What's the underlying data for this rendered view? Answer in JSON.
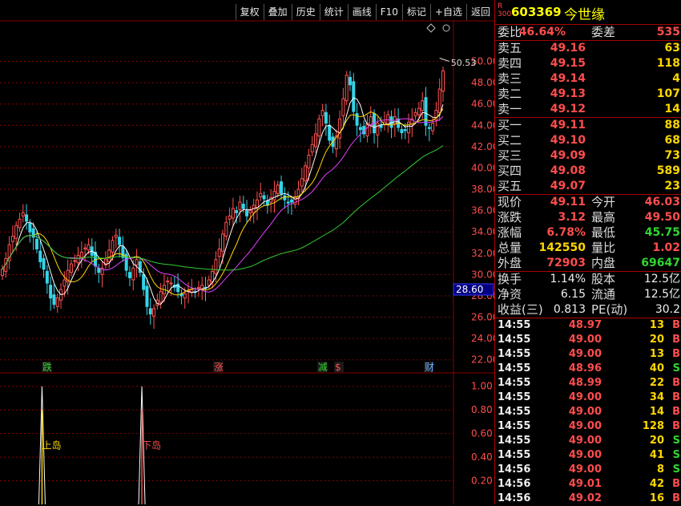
{
  "toolbar": [
    "复权",
    "叠加",
    "历史",
    "统计",
    "画线",
    "F10",
    "标记",
    "+自选",
    "返回"
  ],
  "stock": {
    "r_label": "R",
    "board": "300",
    "code": "603369",
    "name": "今世缘"
  },
  "quote": {
    "weibi_label": "委比",
    "weibi": "46.64%",
    "weicha_label": "委差",
    "weicha": "535",
    "asks": [
      {
        "label": "卖五",
        "price": "49.16",
        "vol": "63"
      },
      {
        "label": "卖四",
        "price": "49.15",
        "vol": "118"
      },
      {
        "label": "卖三",
        "price": "49.14",
        "vol": "4"
      },
      {
        "label": "卖二",
        "price": "49.13",
        "vol": "107"
      },
      {
        "label": "卖一",
        "price": "49.12",
        "vol": "14"
      }
    ],
    "bids": [
      {
        "label": "买一",
        "price": "49.11",
        "vol": "88"
      },
      {
        "label": "买二",
        "price": "49.10",
        "vol": "68"
      },
      {
        "label": "买三",
        "price": "49.09",
        "vol": "73"
      },
      {
        "label": "买四",
        "price": "49.08",
        "vol": "589"
      },
      {
        "label": "买五",
        "price": "49.07",
        "vol": "23"
      }
    ],
    "stats": [
      {
        "l1": "现价",
        "v1": "49.11",
        "c1": "red",
        "l2": "今开",
        "v2": "46.03",
        "c2": "red"
      },
      {
        "l1": "涨跌",
        "v1": "3.12",
        "c1": "red",
        "l2": "最高",
        "v2": "49.50",
        "c2": "red"
      },
      {
        "l1": "涨幅",
        "v1": "6.78%",
        "c1": "red",
        "l2": "最低",
        "v2": "45.75",
        "c2": "green"
      },
      {
        "l1": "总量",
        "v1": "142550",
        "c1": "yellow",
        "l2": "量比",
        "v2": "1.02",
        "c2": "red"
      },
      {
        "l1": "外盘",
        "v1": "72903",
        "c1": "red",
        "l2": "内盘",
        "v2": "69647",
        "c2": "green"
      }
    ],
    "stats2": [
      {
        "l1": "换手",
        "v1": "1.14%",
        "l2": "股本",
        "v2": "12.5亿"
      },
      {
        "l1": "净资",
        "v1": "6.15",
        "l2": "流通",
        "v2": "12.5亿"
      },
      {
        "l1": "收益(三)",
        "v1": "0.813",
        "l2": "PE(动)",
        "v2": "30.2"
      }
    ]
  },
  "ticks": [
    {
      "time": "14:55",
      "price": "48.97",
      "vol": "13",
      "bs": "B"
    },
    {
      "time": "14:55",
      "price": "49.00",
      "vol": "20",
      "bs": "B"
    },
    {
      "time": "14:55",
      "price": "49.00",
      "vol": "13",
      "bs": "B"
    },
    {
      "time": "14:55",
      "price": "48.96",
      "vol": "40",
      "bs": "S"
    },
    {
      "time": "14:55",
      "price": "48.99",
      "vol": "22",
      "bs": "B"
    },
    {
      "time": "14:55",
      "price": "49.00",
      "vol": "34",
      "bs": "B"
    },
    {
      "time": "14:55",
      "price": "49.00",
      "vol": "14",
      "bs": "B"
    },
    {
      "time": "14:55",
      "price": "49.00",
      "vol": "128",
      "bs": "B"
    },
    {
      "time": "14:55",
      "price": "49.00",
      "vol": "20",
      "bs": "S"
    },
    {
      "time": "14:55",
      "price": "49.00",
      "vol": "41",
      "bs": "S"
    },
    {
      "time": "14:56",
      "price": "49.00",
      "vol": "8",
      "bs": "S"
    },
    {
      "time": "14:56",
      "price": "49.01",
      "vol": "42",
      "bs": "B"
    },
    {
      "time": "14:56",
      "price": "49.02",
      "vol": "16",
      "bs": "B"
    }
  ],
  "chart_data": {
    "type": "candlestick",
    "price_axis": [
      22,
      24,
      26,
      28,
      30,
      32,
      34,
      36,
      38,
      40,
      42,
      44,
      46,
      48,
      50
    ],
    "price_tick_labels": [
      "22.00",
      "24.00",
      "26.00",
      "28.00",
      "30.00",
      "32.00",
      "34.00",
      "36.00",
      "38.00",
      "40.00",
      "42.00",
      "44.00",
      "46.00",
      "48.00",
      "50.00"
    ],
    "ylim": [
      21,
      53.5
    ],
    "peak_label": "50.53",
    "current_marker": "28.60",
    "event_markers": [
      {
        "label": "跌",
        "color": "#2fd62f"
      },
      {
        "label": "涨",
        "color": "#ff4d4d"
      },
      {
        "label": "减",
        "color": "#2fd62f"
      },
      {
        "label": "$",
        "color": "#ff4d4d"
      },
      {
        "label": "财",
        "color": "#6ab0ff"
      }
    ],
    "indicator_axis": [
      0.2,
      0.4,
      0.6,
      0.8,
      1.0
    ],
    "indicator_tick_labels": [
      "0.20",
      "0.40",
      "0.60",
      "0.80",
      "1.00"
    ],
    "indicator_ylim": [
      0,
      1.1
    ],
    "indicator_labels": [
      {
        "label": "上岛",
        "color": "#ffd700"
      },
      {
        "label": "下岛",
        "color": "#ff4d4d"
      }
    ],
    "closes": [
      30.5,
      31.5,
      32.8,
      33.6,
      34.6,
      35.2,
      35.8,
      35.0,
      34.0,
      33.5,
      32.4,
      31.2,
      30.5,
      29.2,
      27.8,
      27.2,
      27.8,
      28.6,
      29.5,
      30.4,
      31.0,
      31.3,
      31.8,
      32.1,
      32.5,
      32.8,
      31.8,
      30.8,
      30.2,
      30.6,
      31.4,
      32.3,
      33.2,
      33.7,
      32.8,
      31.6,
      30.4,
      29.7,
      30.6,
      31.4,
      30.2,
      28.6,
      27.0,
      26.3,
      26.8,
      27.6,
      28.4,
      29.0,
      29.4,
      29.2,
      28.8,
      28.4,
      28.0,
      28.2,
      28.5,
      28.6,
      28.4,
      28.8,
      29.0,
      28.7,
      29.5,
      30.3,
      31.4,
      32.4,
      33.8,
      34.9,
      35.5,
      36.2,
      35.8,
      36.8,
      36.2,
      35.5,
      36.0,
      36.5,
      37.0,
      37.6,
      37.1,
      36.5,
      37.2,
      37.8,
      38.4,
      37.6,
      37.0,
      36.7,
      36.8,
      37.3,
      38.0,
      39.0,
      40.2,
      41.2,
      42.2,
      43.2,
      44.6,
      45.4,
      44.2,
      42.6,
      42.0,
      43.0,
      44.6,
      46.5,
      48.7,
      47.8,
      45.3,
      44.0,
      43.6,
      43.2,
      44.2,
      44.8,
      43.3,
      44.2,
      43.8,
      44.3,
      45.0,
      43.8,
      44.8,
      43.8,
      43.3,
      43.5,
      44.3,
      44.6,
      45.2,
      45.6,
      46.3,
      44.0,
      43.7,
      44.2,
      45.4,
      47.4,
      49.11
    ],
    "ma_colors": {
      "ma5": "#ffffff",
      "ma10": "#ffd700",
      "ma20": "#e040fb",
      "ma60": "#32cd32"
    },
    "island_up_index": 15,
    "island_down_index": 44
  },
  "colors": {
    "up": "#ff5252",
    "down": "#35d4e8",
    "grid": "#8b0000",
    "axis_text": "#ff4d4d"
  }
}
